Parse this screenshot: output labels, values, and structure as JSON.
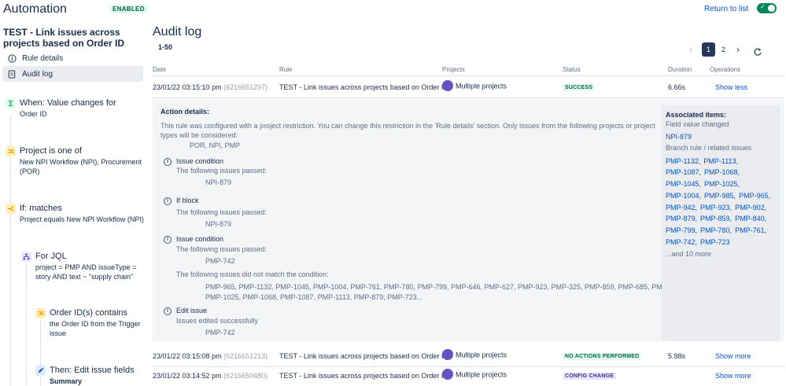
{
  "header": {
    "app_title": "Automation",
    "enabled_badge": "ENABLED",
    "return_link": "Return to list",
    "toggle_state": "on"
  },
  "rule": {
    "name": "TEST - Link issues across projects based on Order ID"
  },
  "nav": {
    "items": [
      {
        "label": "Rule details",
        "icon": "info-icon"
      },
      {
        "label": "Audit log",
        "icon": "document-icon"
      }
    ]
  },
  "steps": [
    {
      "title": "When: Value changes for",
      "desc": [
        "Order ID"
      ],
      "icon": "trigger-icon",
      "color": "#36b37e"
    },
    {
      "title": "Project is one of",
      "desc": [
        "New NPI Workflow (NPI), Procurement",
        "(POR)"
      ],
      "icon": "shuffle-icon",
      "color": "#ffab00"
    },
    {
      "title": "If: matches",
      "desc": [
        "Project equals New NPI Workflow (NPI)"
      ],
      "icon": "branch-icon",
      "color": "#ffab00"
    },
    {
      "title": "For JQL",
      "desc": [
        "project = PMP AND issueType =",
        "story AND text ~ \"supply chain\""
      ],
      "icon": "hierarchy-icon",
      "color": "#6554c0"
    },
    {
      "title": "Order ID(s) contains",
      "desc": [
        "the Order ID from the Trigger",
        "issue"
      ],
      "icon": "shuffle-icon",
      "color": "#ffab00"
    },
    {
      "title": "Then: Edit issue fields",
      "desc": [
        "Summary"
      ],
      "icon": "pencil-icon",
      "color": "#0052cc"
    }
  ],
  "audit": {
    "title": "Audit log",
    "range": "1-50",
    "pagination": {
      "pages": [
        "1",
        "2"
      ],
      "current": "1"
    },
    "columns": [
      "Date",
      "Rule",
      "Projects",
      "Status",
      "Duration",
      "Operations"
    ],
    "rows": [
      {
        "date": "23/01/22 03:15:10 pm",
        "id": "(6216651297)",
        "rule": "TEST - Link issues across projects based on Order ID",
        "projects": "Multiple projects",
        "status": "SUCCESS",
        "status_color": "#006644",
        "duration": "6.66s",
        "operation": "Show less"
      },
      {
        "date": "23/01/22 03:15:08 pm",
        "id": "(6216651213)",
        "rule": "TEST - Link issues across projects based on Order ID",
        "projects": "Multiple projects",
        "status": "NO ACTIONS PERFORMED",
        "status_color": "#006644",
        "duration": "5.98s",
        "operation": "Show more"
      },
      {
        "date": "23/01/22 03:14:52 pm",
        "id": "(6216650480)",
        "rule": "TEST - Link issues across projects based on Order ID",
        "projects": "Multiple projects",
        "status": "CONFIG CHANGE",
        "status_color": "#403294",
        "duration": "",
        "operation": "Show more"
      }
    ]
  },
  "details": {
    "title": "Action details:",
    "restriction_text": [
      "This rule was configured with a project restriction. You can change this restriction in the 'Rule details' section. Only issues from the following projects or project",
      "types will be considered:"
    ],
    "restriction_projects": "POR, NPI, PMP",
    "blocks": [
      {
        "title": "Issue condition",
        "lines": [
          "The following issues passed:"
        ],
        "values": [
          "NPI-879"
        ]
      },
      {
        "title": "If block",
        "lines": [
          "The following issues passed:"
        ],
        "values": [
          "NPI-879"
        ]
      },
      {
        "title": "Issue condition",
        "lines": [
          "The following issues passed:"
        ],
        "values": [
          "PMP-742"
        ],
        "extra_line": "The following issues did not match the condition:",
        "extra_values": [
          "PMP-965, PMP-1132, PMP-1045, PMP-1004, PMP-761, PMP-780, PMP-799, PMP-646, PMP-627, PMP-923, PMP-325, PMP-859, PMP-685, PMP-985,",
          "PMP-1025, PMP-1068, PMP-1087, PMP-1113, PMP-879, PMP-723..."
        ]
      },
      {
        "title": "Edit issue",
        "lines": [
          "Issues edited successfully"
        ],
        "values": [
          "PMP-742"
        ]
      }
    ],
    "associated": {
      "title": "Associated items:",
      "field_label": "Field value changed",
      "field_items": [
        "NPI-879"
      ],
      "branch_label": "Branch rule / related issues",
      "branch_lines": [
        [
          "PMP-1132,",
          "PMP-1113,"
        ],
        [
          "PMP-1087,",
          "PMP-1068,"
        ],
        [
          "PMP-1045,",
          "PMP-1025,"
        ],
        [
          "PMP-1004,",
          "PMP-985,",
          "PMP-965,"
        ],
        [
          "PMP-942,",
          "PMP-923,",
          "PMP-902,"
        ],
        [
          "PMP-879,",
          "PMP-859,",
          "PMP-840,"
        ],
        [
          "PMP-799,",
          "PMP-780,",
          "PMP-761,"
        ],
        [
          "PMP-742,",
          "PMP-723"
        ]
      ],
      "more": "...and 10 more"
    }
  }
}
